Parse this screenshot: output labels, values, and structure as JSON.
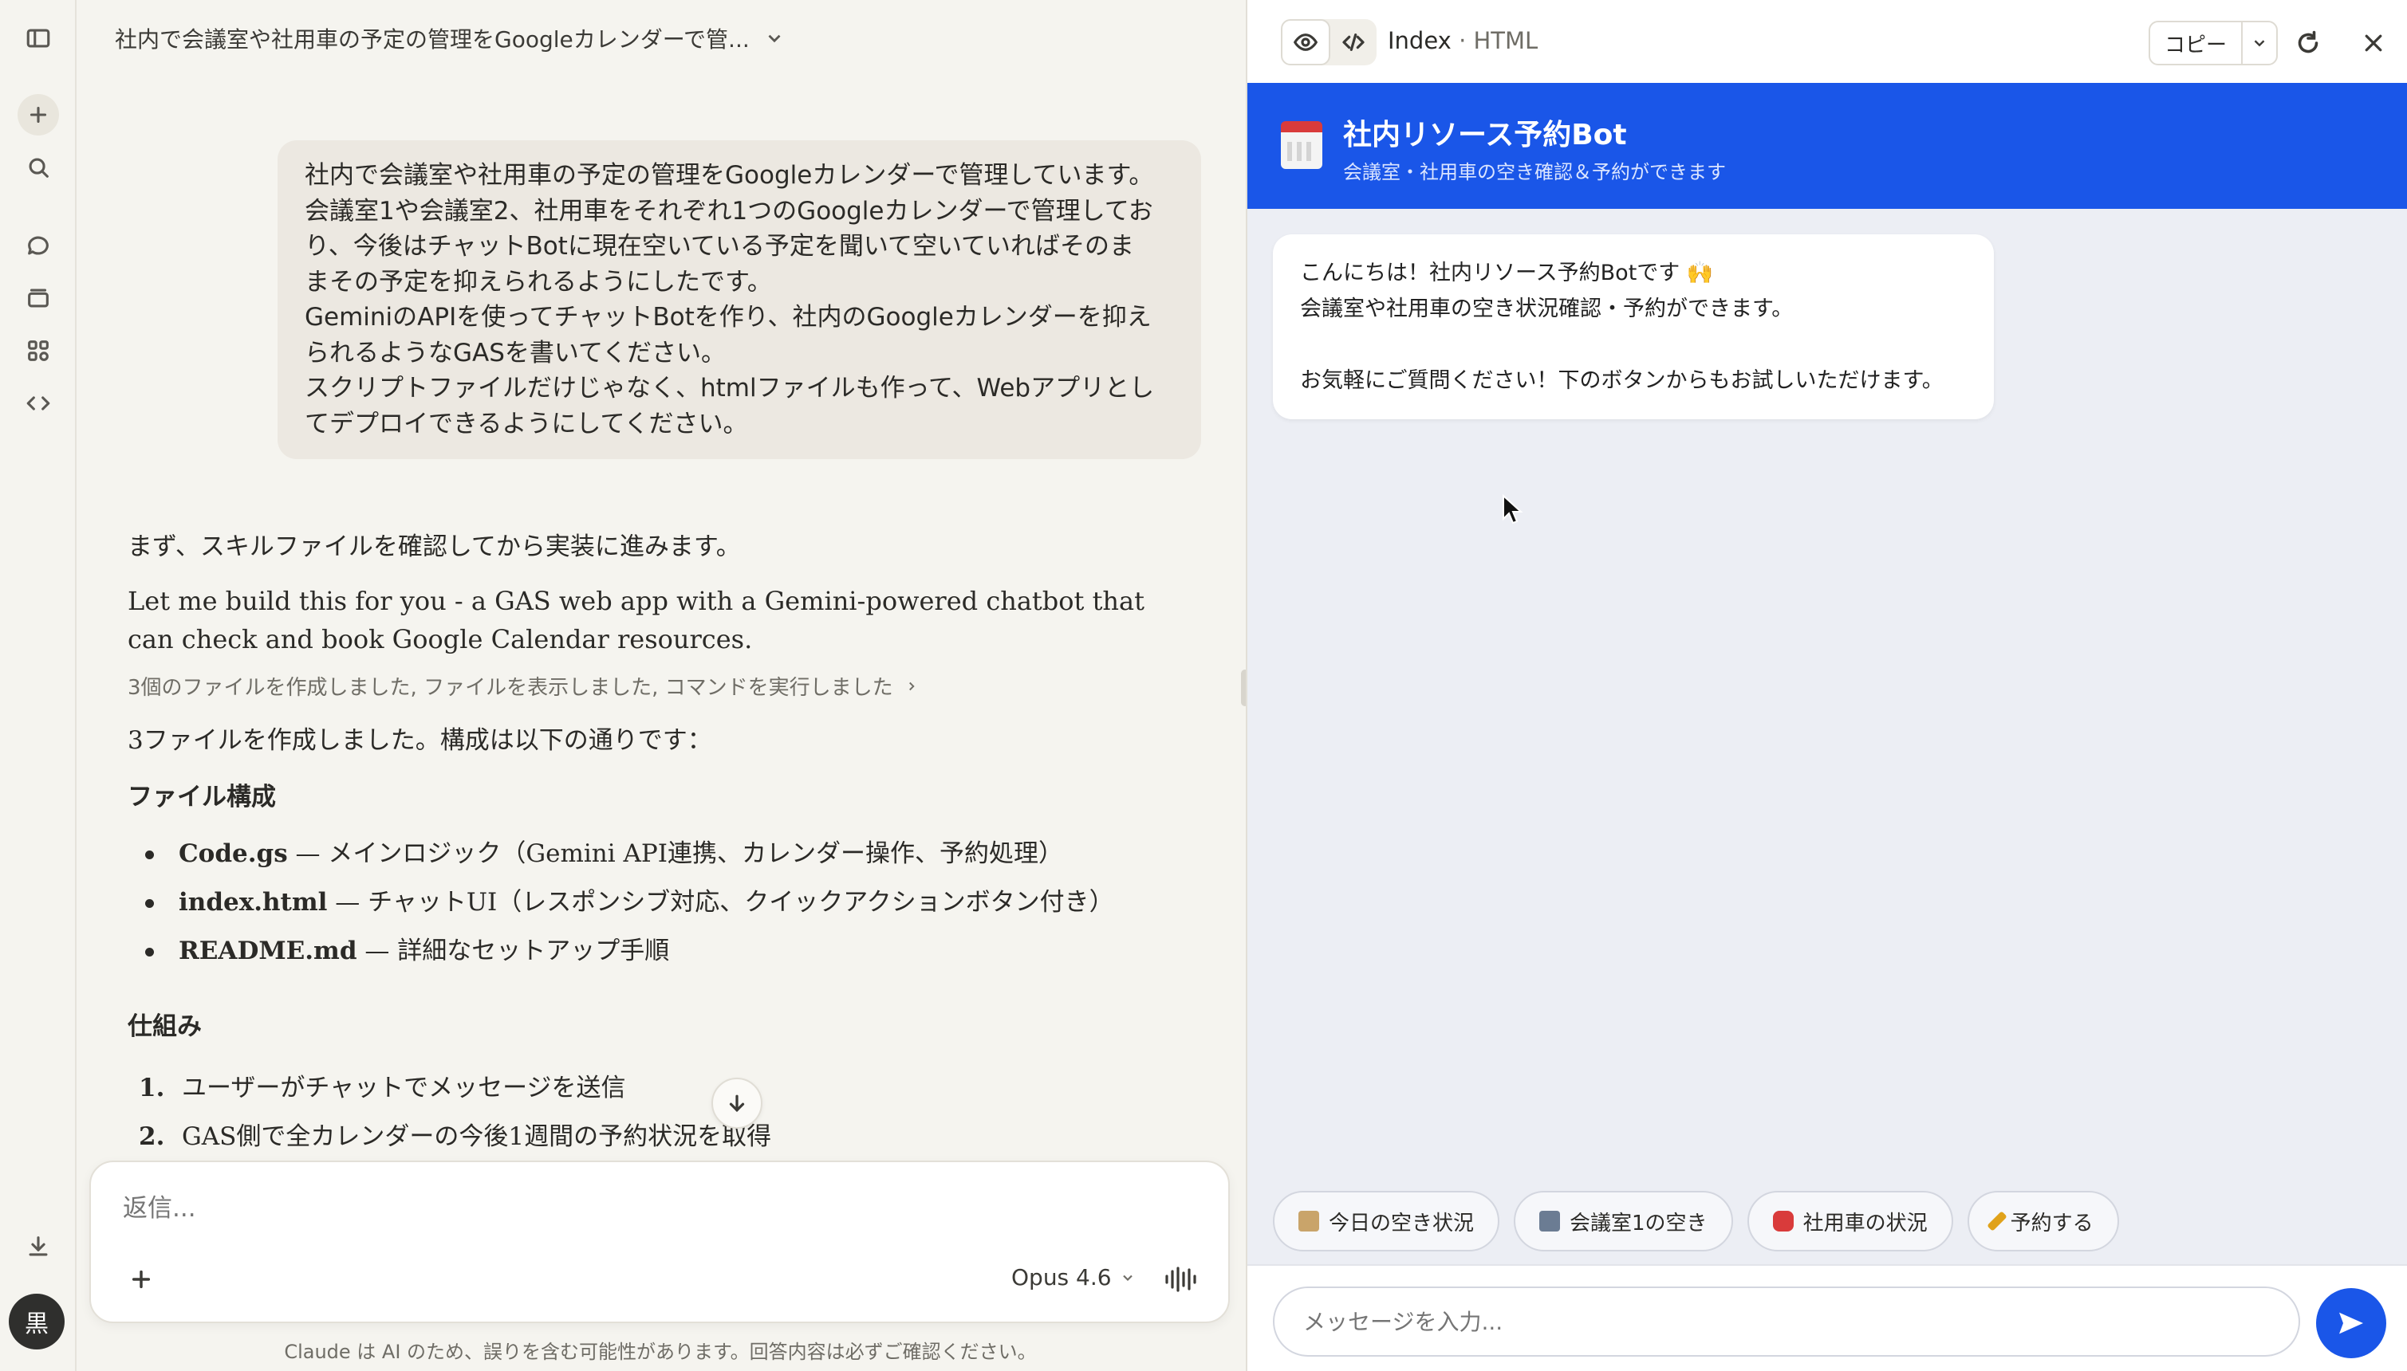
{
  "chat": {
    "title": "社内で会議室や社用車の予定の管理をGoogleカレンダーで管...",
    "user_message": [
      "社内で会議室や社用車の予定の管理をGoogleカレンダーで管理しています。",
      "会議室1や会議室2、社用車をそれぞれ1つのGoogleカレンダーで管理してお",
      "り、今後はチャットBotに現在空いている予定を聞いて空いていればそのま",
      "まその予定を抑えられるようにしたです。",
      "GeminiのAPIを使ってチャットBotを作り、社内のGoogleカレンダーを抑え",
      "られるようなGASを書いてください。",
      "スクリプトファイルだけじゃなく、htmlファイルも作って、Webアプリとし",
      "てデプロイできるようにしてください。"
    ],
    "assistant_intro": "まず、スキルファイルを確認してから実装に進みます。",
    "assistant_en": "Let me build this for you - a GAS web app with a Gemini-powered chatbot that can check and book Google Calendar resources.",
    "tool_summary": "3個のファイルを作成しました, ファイルを表示しました, コマンドを実行しました",
    "files_made": "3ファイルを作成しました。構成は以下の通りです：",
    "files_heading": "ファイル構成",
    "files": [
      {
        "name": "Code.gs",
        "desc": " — メインロジック（Gemini API連携、カレンダー操作、予約処理）"
      },
      {
        "name": "index.html",
        "desc": " — チャットUI（レスポンシブ対応、クイックアクションボタン付き）"
      },
      {
        "name": "README.md",
        "desc": " — 詳細なセットアップ手順"
      }
    ],
    "mechanism_heading": "仕組み",
    "steps": [
      {
        "n": "1.",
        "text": "ユーザーがチャットでメッセージを送信"
      },
      {
        "n": "2.",
        "text": "GAS側で全カレンダーの今後1週間の予約状況を取得"
      }
    ],
    "composer_placeholder": "返信...",
    "model": "Opus 4.6",
    "disclaimer": "Claude は AI のため、誤りを含む可能性があります。回答内容は必ずご確認ください。",
    "avatar": "黒"
  },
  "panel": {
    "name": "Index",
    "type": "· HTML",
    "copy_label": "コピー"
  },
  "app": {
    "title": "社内リソース予約Bot",
    "subtitle": "会議室・社用車の空き確認＆予約ができます",
    "welcome": [
      "こんにちは！社内リソース予約Botです 🙌",
      "会議室や社用車の空き状況確認・予約ができます。",
      "",
      "お気軽にご質問ください！下のボタンからもお試しいただけます。"
    ],
    "chips": [
      {
        "icon": "clipboard-icon",
        "label": "今日の空き状況",
        "color": "#c9a46a"
      },
      {
        "icon": "building-icon",
        "label": "会議室1の空き",
        "color": "#6b7c93"
      },
      {
        "icon": "car-icon",
        "label": "社用車の状況",
        "color": "#d93b3b"
      },
      {
        "icon": "pencil-icon",
        "label": "予約する",
        "color": "#e0a21a"
      }
    ],
    "input_placeholder": "メッセージを入力...",
    "accent": "#1a56e8"
  }
}
